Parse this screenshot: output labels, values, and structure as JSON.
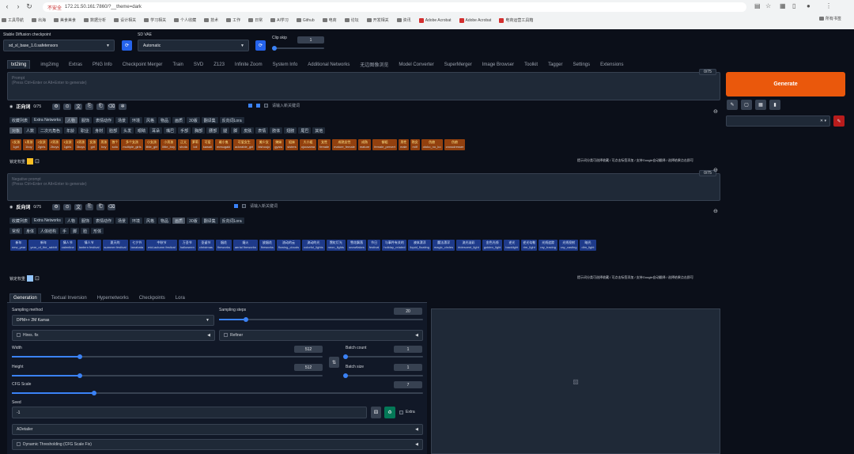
{
  "browser": {
    "security_label": "不安全",
    "url": "172.21.50.161:7860/?__theme=dark",
    "bookmarks": [
      "工具导航",
      "出海",
      "美食美食",
      "数据分析",
      "设计相关",
      "学习相关",
      "个人收藏",
      "技术",
      "工作",
      "日常",
      "AI学习",
      "Github",
      "电商",
      "论坛",
      "开发相关",
      "资讯"
    ],
    "bookmark_tools": [
      "Adobe Acrobat",
      "Adobe Acrobat",
      "电商运营工具箱"
    ],
    "right_bookmarks": [
      "所有书签"
    ]
  },
  "top": {
    "checkpoint_label": "Stable Diffusion checkpoint",
    "checkpoint_value": "sd_xl_base_1.0.safetensors",
    "vae_label": "SD VAE",
    "vae_value": "Automatic",
    "clip_label": "Clip skip",
    "clip_value": "1"
  },
  "tabs": [
    "txt2img",
    "img2img",
    "Extras",
    "PNG Info",
    "Checkpoint Merger",
    "Train",
    "SVD",
    "Z123",
    "Infinite Zoom",
    "System Info",
    "Additional Networks",
    "无边图像浏览",
    "Model Converter",
    "SuperMerger",
    "Image Browser",
    "Toolkit",
    "Tagger",
    "Settings",
    "Extensions"
  ],
  "prompt": {
    "counter": "0/75",
    "placeholder": "Prompt\n(Press Ctrl+Enter or Alt+Enter to generate)"
  },
  "negative": {
    "counter": "0/75",
    "placeholder": "Negative prompt\n(Press Ctrl+Enter or Alt+Enter to generate)"
  },
  "generate": {
    "label": "Generate"
  },
  "pos_toolbar": {
    "title": "正向词",
    "counter": "0/75",
    "input_placeholder": "请输入新关键词"
  },
  "neg_toolbar": {
    "title": "反向词",
    "counter": "0/75",
    "input_placeholder": "请输入新关键词"
  },
  "pos_cats": [
    "收藏列表",
    "Extra Networks",
    "人物",
    "服饰",
    "表情动作",
    "场景",
    "环境",
    "风格",
    "物品",
    "画质",
    "30版",
    "翻译集",
    "反向词Lora"
  ],
  "pos_subcats": [
    "对象",
    "人数",
    "二次元角色",
    "年龄",
    "职业",
    "身材",
    "脸部",
    "头发",
    "眼睛",
    "耳朵",
    "嘴巴",
    "手部",
    "胸部",
    "腰部",
    "腿",
    "脚",
    "皮肤",
    "表情",
    "肢体",
    "翅膀",
    "尾巴",
    "其他"
  ],
  "pos_chips": [
    {
      "zh": "1女孩",
      "en": "1girl"
    },
    {
      "zh": "1男孩",
      "en": "1boy"
    },
    {
      "zh": "2女孩",
      "en": "2girls"
    },
    {
      "zh": "2男孩",
      "en": "2boys"
    },
    {
      "zh": "1女孩",
      "en": "1girls"
    },
    {
      "zh": "3男孩",
      "en": "3boys"
    },
    {
      "zh": "女孩",
      "en": "girl"
    },
    {
      "zh": "男孩",
      "en": "boy"
    },
    {
      "zh": "独个",
      "en": "solo"
    },
    {
      "zh": "多个女孩",
      "en": "multiple_girls"
    },
    {
      "zh": "小女孩",
      "en": "little_girl"
    },
    {
      "zh": "小男孩",
      "en": "little_boy"
    },
    {
      "zh": "正太",
      "en": "shota"
    },
    {
      "zh": "萝莉",
      "en": "loli"
    },
    {
      "zh": "可爱",
      "en": "kawaii"
    },
    {
      "zh": "雌小鬼",
      "en": "mesugaki"
    },
    {
      "zh": "可爱女生",
      "en": "adorable_girl"
    },
    {
      "zh": "美少女",
      "en": "bishoujo"
    },
    {
      "zh": "辣妹",
      "en": "gyaru"
    },
    {
      "zh": "姐妹",
      "en": "sisters"
    },
    {
      "zh": "大小姐",
      "en": "ojousama"
    },
    {
      "zh": "女性",
      "en": "female"
    },
    {
      "zh": "成熟女性",
      "en": "mature_female"
    },
    {
      "zh": "成熟",
      "en": "mature"
    },
    {
      "zh": "御姐",
      "en": "female_pervert"
    },
    {
      "zh": "男性",
      "en": "male"
    },
    {
      "zh": "熟女",
      "en": "milf"
    },
    {
      "zh": "伪娘",
      "en": "otoko_no_ko"
    },
    {
      "zh": "伪娘",
      "en": "crossdresser"
    }
  ],
  "pos_footer": "提示词分类可选择收藏 / 可点击标签添加 / 支持Google自动翻译 / 选择结果点击即可",
  "lock_label": "锁定权重",
  "neg_cats": [
    "收藏列表",
    "Extra Networks",
    "人物",
    "服饰",
    "表情动作",
    "场景",
    "环境",
    "风格",
    "物品",
    "画质",
    "30版",
    "翻译集",
    "反向词Lora"
  ],
  "neg_subcats": [
    "常规",
    "身体",
    "人体结构",
    "手",
    "脚",
    "脸",
    "形体"
  ],
  "neg_chips": [
    {
      "zh": "新年",
      "en": "new_year"
    },
    {
      "zh": "新年",
      "en": "year_of_the_rabbit"
    },
    {
      "zh": "情人节",
      "en": "valentine"
    },
    {
      "zh": "情人节",
      "en": "lantern festival"
    },
    {
      "zh": "夏天的",
      "en": "summer festival"
    },
    {
      "zh": "七夕节",
      "en": "tanabata"
    },
    {
      "zh": "中秋节",
      "en": "mid-autumn festival"
    },
    {
      "zh": "万圣节",
      "en": "halloween"
    },
    {
      "zh": "圣诞节",
      "en": "christmas"
    },
    {
      "zh": "烟花",
      "en": "fireworks"
    },
    {
      "zh": "烟火",
      "en": "aerial fireworks"
    },
    {
      "zh": "放烟花",
      "en": "fireworks"
    },
    {
      "zh": "流动的云",
      "en": "flowing_clouds"
    },
    {
      "zh": "流动的光",
      "en": "colorful_lights"
    },
    {
      "zh": "霓虹灯光",
      "en": "neon_lights"
    },
    {
      "zh": "雪花飘落",
      "en": "snowflakes"
    },
    {
      "zh": "节日",
      "en": "festival"
    },
    {
      "zh": "与事件有关的",
      "en": "holiday_related"
    },
    {
      "zh": "液体漂浮",
      "en": "liquid_floating"
    },
    {
      "zh": "魔法漂浮",
      "en": "magic_circles"
    },
    {
      "zh": "流光溢彩",
      "en": "iridescent_light"
    },
    {
      "zh": "金色光线",
      "en": "golden_light"
    },
    {
      "zh": "逆光",
      "en": "backlight"
    },
    {
      "zh": "逆光勾勒",
      "en": "rim_light"
    },
    {
      "zh": "光线追踪",
      "en": "ray_tracing"
    },
    {
      "zh": "光线投射",
      "en": "ray_casting"
    },
    {
      "zh": "暗光",
      "en": "dim_light"
    }
  ],
  "neg_footer": "提示词分类可选择收藏 / 可点击标签添加 / 支持Google自动翻译 / 选择结果点击即可",
  "gen_tabs": [
    "Generation",
    "Textual Inversion",
    "Hypernetworks",
    "Checkpoints",
    "Lora"
  ],
  "sampling": {
    "method_label": "Sampling method",
    "method_value": "DPM++ 2M Karras",
    "steps_label": "Sampling steps",
    "steps_value": "20",
    "steps_fraction": 0.13
  },
  "hires_label": "Hires. fix",
  "refiner_label": "Refiner",
  "width": {
    "label": "Width",
    "value": "512",
    "fraction": 0.22
  },
  "height": {
    "label": "Height",
    "value": "512",
    "fraction": 0.22
  },
  "batch_count": {
    "label": "Batch count",
    "value": "1",
    "fraction": 0.0
  },
  "batch_size": {
    "label": "Batch size",
    "value": "1",
    "fraction": 0.0
  },
  "swap_icon": "⇅",
  "cfg": {
    "label": "CFG Scale",
    "value": "7",
    "fraction": 0.2
  },
  "seed": {
    "label": "Seed",
    "value": "-1",
    "extra_label": "Extra"
  },
  "adetailer_label": "ADetailer",
  "dynamic_label": "Dynamic Thresholding (CFG Scale Fix)",
  "colors": {
    "accent": "#ea580c",
    "blue": "#2563eb",
    "chip_orange": "#92400e",
    "chip_blue": "#1e3a8a",
    "bg": "#0b0f19"
  }
}
